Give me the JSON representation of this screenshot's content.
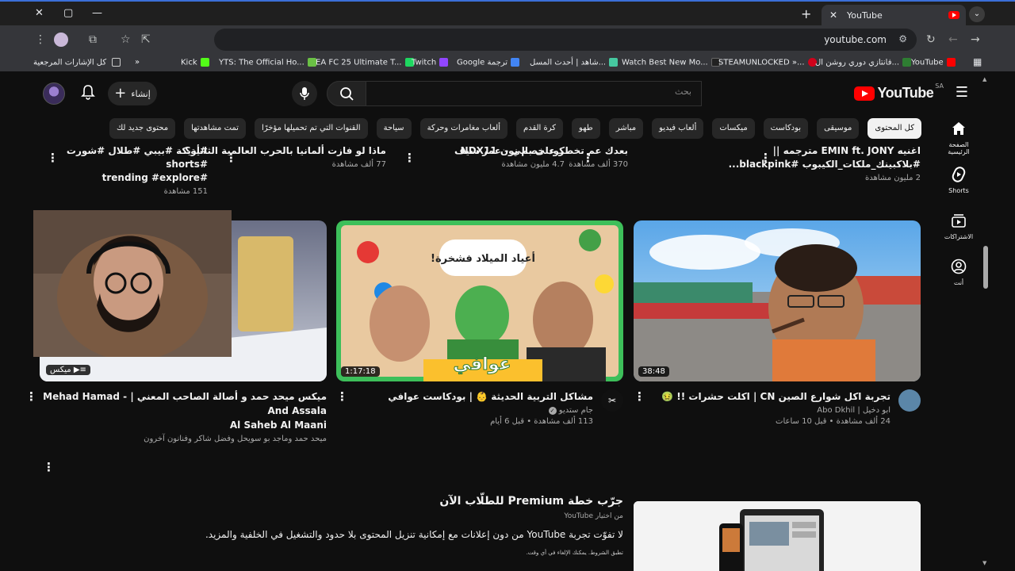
{
  "browser": {
    "tab_title": "YouTube",
    "url": "youtube.com",
    "bookmarks": [
      {
        "label": "كل الإشارات المرجعية",
        "color": "#888888"
      },
      {
        "label": "Kick",
        "color": "#53fc18"
      },
      {
        "label": "YTS: The Official Ho...",
        "color": "#6ac045"
      },
      {
        "label": "EA FC 25 Ultimate T...",
        "color": "#1ed760"
      },
      {
        "label": "Twitch",
        "color": "#9146ff"
      },
      {
        "label": "Google ترجمة",
        "color": "#4285f4"
      },
      {
        "label": "شاهد | أحدث المسل...",
        "color": "#46c8a0"
      },
      {
        "label": "Watch Best New Mo...",
        "color": "#222222"
      },
      {
        "label": "STEAMUNLOCKED »...",
        "color": "#d0021b"
      },
      {
        "label": "فانتازي دوري روشن ال...",
        "color": "#2e7d32"
      },
      {
        "label": "YouTube",
        "color": "#ff0000"
      }
    ]
  },
  "masthead": {
    "logo_text": "YouTube",
    "country": "SA",
    "search_placeholder": "بحث",
    "create_label": "إنشاء"
  },
  "chips": [
    "كل المحتوى",
    "موسيقى",
    "بودكاست",
    "ميكسات",
    "ألعاب فيديو",
    "مباشر",
    "طهو",
    "كرة القدم",
    "ألعاب مغامرات وحركة",
    "سياحة",
    "القنوات التي تم تحميلها مؤخرًا",
    "تمت مشاهدتها",
    "محتوى جديد لك"
  ],
  "guide": [
    {
      "label": "الصفحة الرئيسية",
      "icon": "home-icon"
    },
    {
      "label": "Shorts",
      "icon": "shorts-icon"
    },
    {
      "label": "الاشتراكات",
      "icon": "subscriptions-icon"
    },
    {
      "label": "أنت",
      "icon": "you-icon"
    }
  ],
  "top_row": [
    {
      "title1": "اغنيه EMIN ft. JONY مترجمه ||",
      "title2": "#بلاكبينك_ملكات_الكيبوب #blackpink...",
      "meta": "2 مليون مشاهدة"
    },
    {
      "title1": "بعدك عم تخطر على بالي - عمر سيف",
      "title2": "",
      "meta": "370 ألف مشاهدة"
    },
    {
      "title1": "كود خصم نون NDX11",
      "title2": "",
      "meta": "4.7 مليون مشاهدة"
    },
    {
      "title1": "ماذا لو فازت ألمانيا بالحرب العالمية الثانية؟",
      "title2": "",
      "meta": "77 ألف مشاهدة"
    },
    {
      "title1": "#أريكة #بيبي #طلال #شورت #shorts",
      "title2": "#trending #explore",
      "meta": "151 مشاهدة"
    }
  ],
  "videos": [
    {
      "title": "تجربة اكل شوارع الصين CN | اكلت حشرات !! 🤢",
      "channel": "ابو دخيل | Abo Dkhil",
      "meta": "24 ألف مشاهدة • قبل 10 ساعات",
      "duration": "38:48"
    },
    {
      "title": "مشاكل التربية الحديثة 👶 | بودكاست عوافي",
      "channel": "جام ستديو",
      "meta": "113 ألف مشاهدة • قبل 6 أيام",
      "duration": "1:17:18",
      "thumb_text": "أعياد الميلاد فشخرة!",
      "thumb_caption": "عوافي"
    },
    {
      "title": "ميكس ميحد حمد و أصالة الصاحب المعني | - Mehad Hamad And Assala",
      "title2": "Al Saheb Al Maani",
      "channel": "ميحد حمد وماجد بو سويحل وفضل شاكر وفنانون آخرون",
      "badge": "ميكس"
    }
  ],
  "premium": {
    "title": "جرّب خطة Premium للطلّاب الآن",
    "subtitle": "من اختيار YouTube",
    "description": "لا تفوّت تجربة YouTube من دون إعلانات مع إمكانية تنزيل المحتوى بلا حدود والتشغيل في الخلفية والمزيد.",
    "terms": "تطبق الشروط. يمكنك الإلغاء في أي وقت."
  }
}
